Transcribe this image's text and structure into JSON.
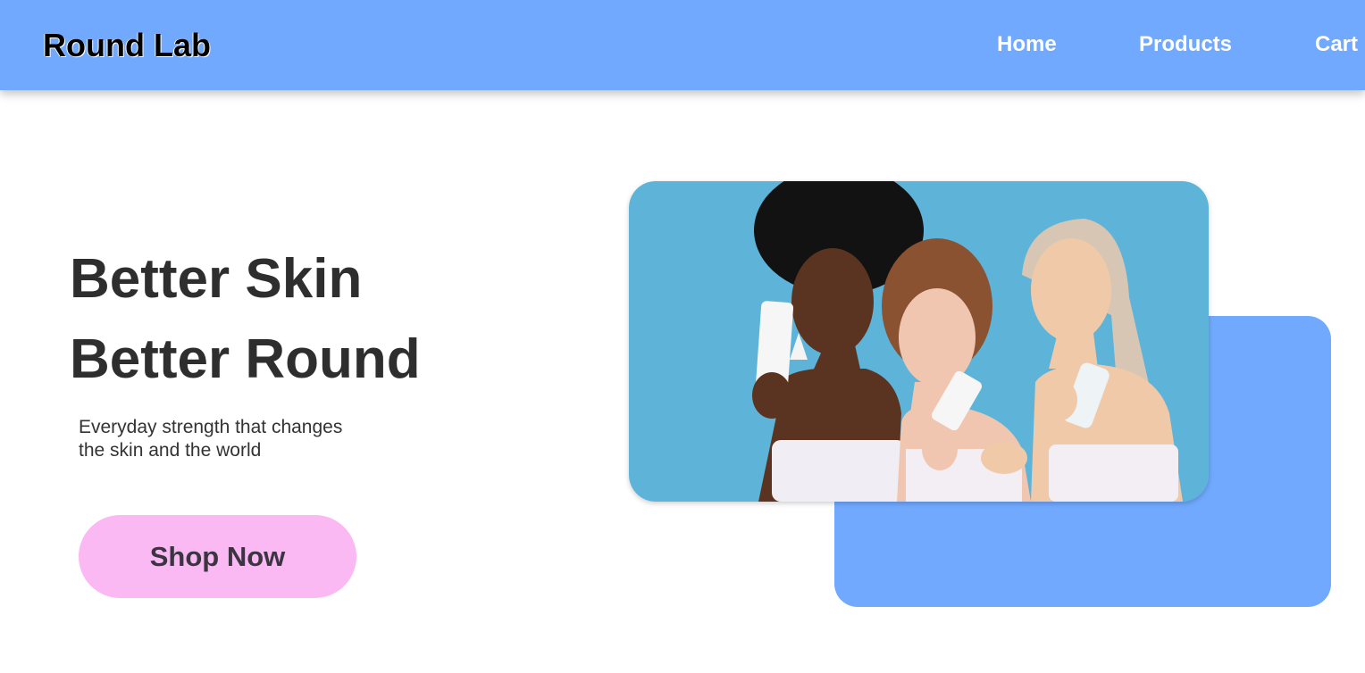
{
  "header": {
    "brand": "Round Lab",
    "nav": [
      "Home",
      "Products",
      "Cart"
    ]
  },
  "hero": {
    "headline_line1": "Better Skin",
    "headline_line2": "Better Round",
    "subtitle_line1": "Everyday strength that changes",
    "subtitle_line2": "the skin and the world",
    "cta_label": "Shop Now"
  },
  "colors": {
    "nav_bg": "#70a9fe",
    "cta_bg": "#fbb9f3",
    "accent_box": "#70a9fe",
    "photo_bg": "#5eb4d8",
    "heading_text": "#2e2e2e"
  }
}
